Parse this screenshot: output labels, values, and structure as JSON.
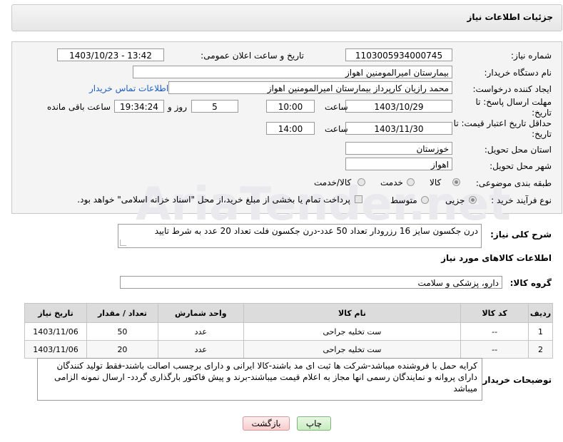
{
  "header": {
    "title": "جزئیات اطلاعات نیاز"
  },
  "form": {
    "need_number": {
      "label": "شماره نیاز:",
      "value": "1103005934000745"
    },
    "public_announce": {
      "label": "تاریخ و ساعت اعلان عمومی:",
      "value": "1403/10/23 - 13:42"
    },
    "buyer_org": {
      "label": "نام دستگاه خریدار:",
      "value": "بیمارستان امیرالمومنین اهواز"
    },
    "requester": {
      "label": "ایجاد کننده درخواست:",
      "value": "محمد رازیان کارپرداز بیمارستان امیرالمومنین اهواز",
      "contact_link": "اطلاعات تماس خریدار"
    },
    "reply_deadline": {
      "label": "مهلت ارسال پاسخ: تا تاریخ:",
      "date": "1403/10/29",
      "time_label": "ساعت",
      "time": "10:00",
      "days": "5",
      "days_label": "روز و",
      "remaining": "19:34:24",
      "remaining_label": "ساعت باقی مانده"
    },
    "price_validity": {
      "label": "حداقل تاریخ اعتبار قیمت: تا تاریخ:",
      "date": "1403/11/30",
      "time_label": "ساعت",
      "time": "14:00"
    },
    "province": {
      "label": "استان محل تحویل:",
      "value": "خوزستان"
    },
    "city": {
      "label": "شهر محل تحویل:",
      "value": "اهواز"
    },
    "category": {
      "label": "طبقه بندی موضوعی:",
      "options": [
        "کالا",
        "خدمت",
        "کالا/خدمت"
      ]
    },
    "purchase_type": {
      "label": "نوع فرآیند خرید :",
      "options": [
        "جزیی",
        "متوسط"
      ],
      "payment_note": "پرداخت تمام یا بخشی از مبلغ خرید،از محل \"اسناد خزانه اسلامی\" خواهد بود."
    }
  },
  "summary": {
    "label": "شرح کلی نیاز:",
    "value": "درن جکسون سایز 16 رزرودار تعداد 50 عدد-درن جکسون فلت تعداد 20 عدد به شرط تایید"
  },
  "goods_section_title": "اطلاعات کالاهای مورد نیاز",
  "goods_group": {
    "label": "گروه کالا:",
    "value": "دارو، پزشکی و سلامت"
  },
  "table": {
    "headers": [
      "ردیف",
      "کد کالا",
      "نام کالا",
      "واحد شمارش",
      "تعداد / مقدار",
      "تاریخ نیاز"
    ],
    "rows": [
      [
        "1",
        "--",
        "ست تخلیه جراحی",
        "عدد",
        "50",
        "1403/11/06"
      ],
      [
        "2",
        "--",
        "ست تخلیه جراحی",
        "عدد",
        "20",
        "1403/11/06"
      ]
    ]
  },
  "buyer_notes": {
    "label": "توضیحات خریدار:",
    "value": "کرایه حمل با فروشنده میباشد-شرکت ها ثبت ای مد باشند-کالا ایرانی و دارای برچسب اصالت باشند-فقط تولید کنندگان دارای پروانه و نمایندگان رسمی انها مجاز به اعلام قیمت میباشند-برند و پیش فاکتور بارگذاری گردد- ارسال نمونه الزامی میباشد"
  },
  "buttons": {
    "print": "چاپ",
    "back": "بازگشت"
  },
  "watermark": "AriaTender.net"
}
